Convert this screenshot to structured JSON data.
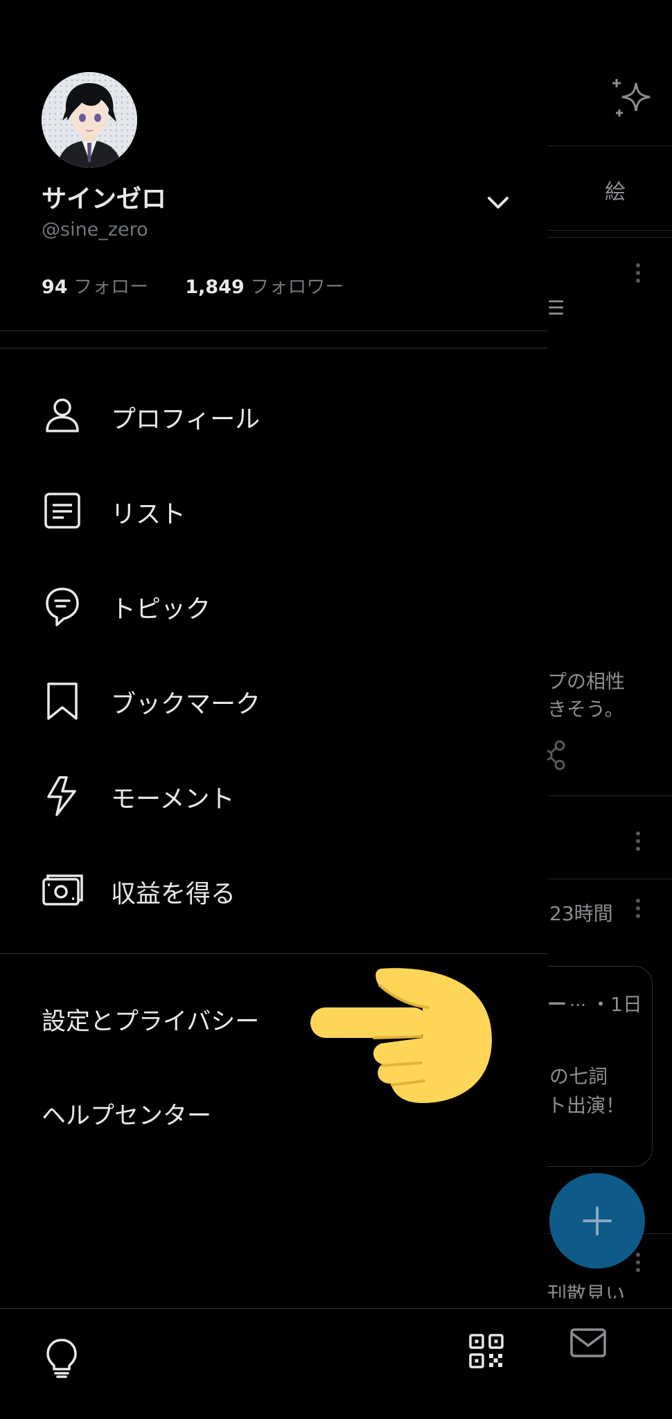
{
  "profile": {
    "name": "サインゼロ",
    "handle": "@sine_zero",
    "following_count": "94",
    "following_label": "フォロー",
    "followers_count": "1,849",
    "followers_label": "フォロワー"
  },
  "menu": [
    {
      "label": "プロフィール",
      "icon": "person-icon"
    },
    {
      "label": "リスト",
      "icon": "list-icon"
    },
    {
      "label": "トピック",
      "icon": "topic-icon"
    },
    {
      "label": "ブックマーク",
      "icon": "bookmark-icon"
    },
    {
      "label": "モーメント",
      "icon": "lightning-icon"
    },
    {
      "label": "収益を得る",
      "icon": "money-icon"
    }
  ],
  "secondary": {
    "settings_label": "設定とプライバシー",
    "help_label": "ヘルプセンター"
  },
  "background": {
    "tab_label": "絵",
    "snippet_1a": "プの相性",
    "snippet_1b": "きそう。",
    "time_1": "23時間",
    "time_2": "・1日",
    "ellipsis": "…",
    "snippet_2a": "の七詞",
    "snippet_2b": "ト出演！",
    "snippet_3": "刊散見い"
  },
  "colors": {
    "background": "#000000",
    "accent": "#1d9bf0",
    "pointer_hand": "#ffd657",
    "muted_text": "#71767b"
  }
}
